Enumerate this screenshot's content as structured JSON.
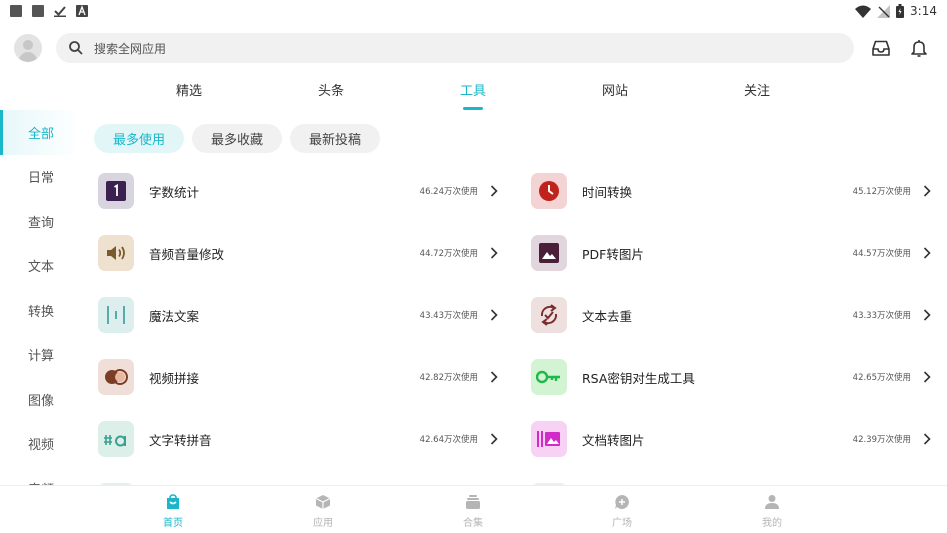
{
  "status_bar": {
    "time": "3:14"
  },
  "search": {
    "placeholder": "搜索全网应用"
  },
  "tabs": [
    {
      "label": "精选"
    },
    {
      "label": "头条"
    },
    {
      "label": "工具",
      "active": true
    },
    {
      "label": "网站"
    },
    {
      "label": "关注"
    }
  ],
  "sidebar": {
    "items": [
      {
        "label": "全部",
        "active": true
      },
      {
        "label": "日常"
      },
      {
        "label": "查询"
      },
      {
        "label": "文本"
      },
      {
        "label": "转换"
      },
      {
        "label": "计算"
      },
      {
        "label": "图像"
      },
      {
        "label": "视频"
      },
      {
        "label": "音频"
      }
    ]
  },
  "chips": [
    {
      "label": "最多使用",
      "active": true
    },
    {
      "label": "最多收藏"
    },
    {
      "label": "最新投稿"
    }
  ],
  "apps": {
    "left": [
      {
        "name": "字数统计",
        "uses": "46.24万次使用",
        "icon": "counter-icon",
        "bg": "#d8d4e0"
      },
      {
        "name": "音频音量修改",
        "uses": "44.72万次使用",
        "icon": "speaker-icon",
        "bg": "#efe1cf"
      },
      {
        "name": "魔法文案",
        "uses": "43.43万次使用",
        "icon": "magic-text-icon",
        "bg": "#dcefee"
      },
      {
        "name": "视频拼接",
        "uses": "42.82万次使用",
        "icon": "video-merge-icon",
        "bg": "#f0dfd8"
      },
      {
        "name": "文字转拼音",
        "uses": "42.64万次使用",
        "icon": "pinyin-icon",
        "bg": "#dcefe9"
      }
    ],
    "right": [
      {
        "name": "时间转换",
        "uses": "45.12万次使用",
        "icon": "clock-icon",
        "bg": "#f3d3d3"
      },
      {
        "name": "PDF转图片",
        "uses": "44.57万次使用",
        "icon": "image-icon",
        "bg": "#e2d6de"
      },
      {
        "name": "文本去重",
        "uses": "43.33万次使用",
        "icon": "dedupe-icon",
        "bg": "#ede0de"
      },
      {
        "name": "RSA密钥对生成工具",
        "uses": "42.65万次使用",
        "icon": "key-icon",
        "bg": "#d2f4d2"
      },
      {
        "name": "文档转图片",
        "uses": "42.39万次使用",
        "icon": "doc-image-icon",
        "bg": "#f7d2f4"
      }
    ]
  },
  "bottom_nav": [
    {
      "label": "首页",
      "active": true,
      "icon": "home-icon"
    },
    {
      "label": "应用",
      "icon": "cube-icon"
    },
    {
      "label": "合集",
      "icon": "collection-icon"
    },
    {
      "label": "广场",
      "icon": "chat-icon"
    },
    {
      "label": "我的",
      "icon": "person-icon"
    }
  ],
  "colors": {
    "accent": "#19b7c9"
  }
}
